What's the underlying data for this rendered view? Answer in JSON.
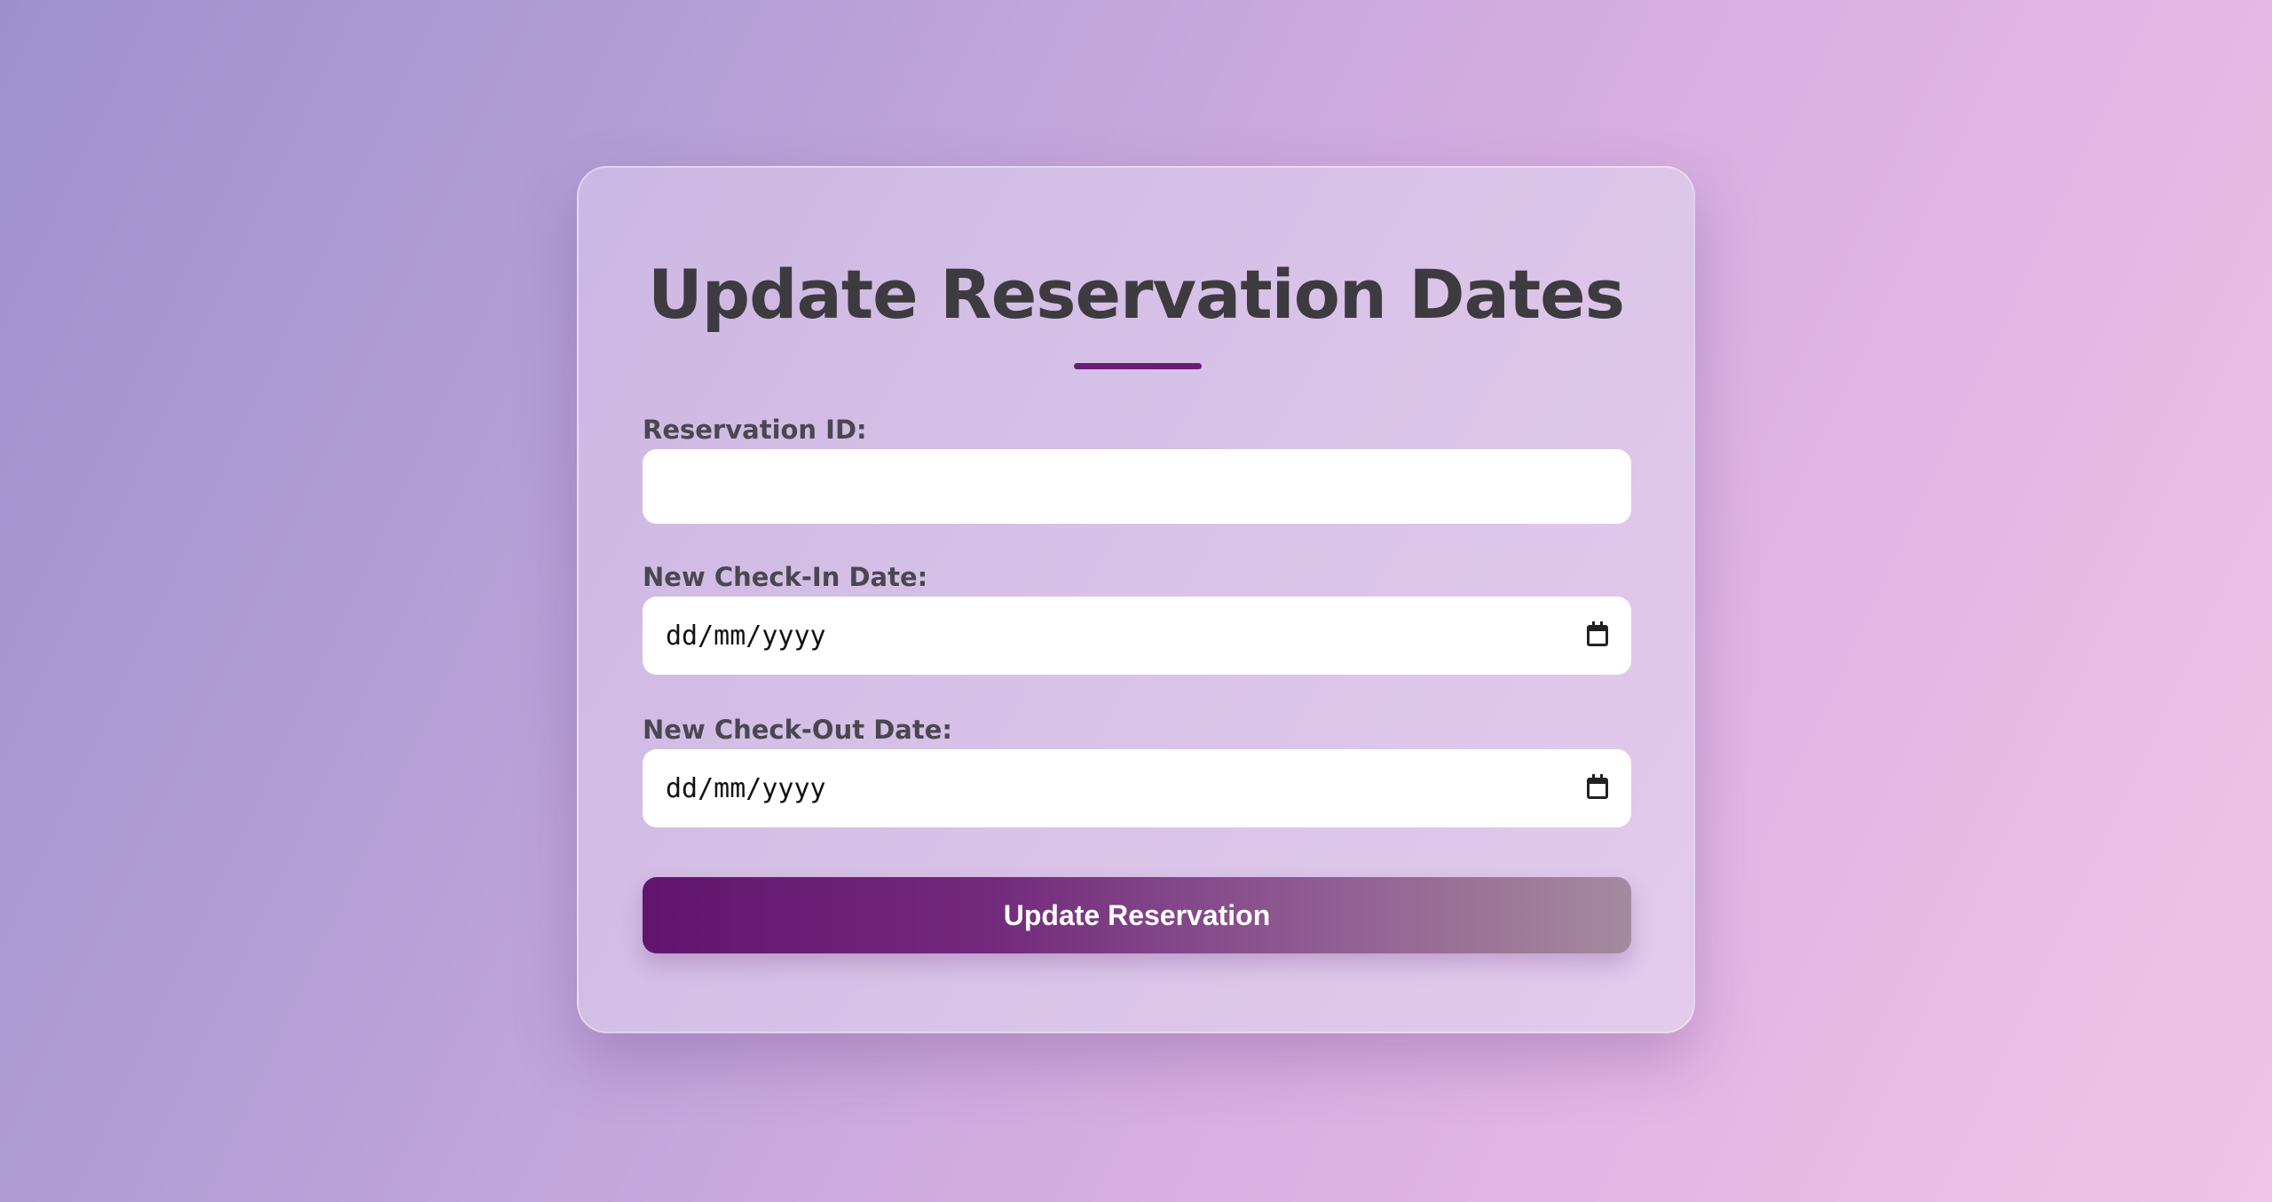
{
  "form": {
    "title": "Update Reservation Dates",
    "reservation_id": {
      "label": "Reservation ID:",
      "value": ""
    },
    "check_in": {
      "label": "New Check-In Date:",
      "placeholder": "dd/mm/yyyy",
      "icon": "calendar-icon"
    },
    "check_out": {
      "label": "New Check-Out Date:",
      "placeholder": "dd/mm/yyyy",
      "icon": "calendar-icon"
    },
    "submit_label": "Update Reservation"
  },
  "colors": {
    "accent": "#6a1b7a",
    "title_text": "#3e3b40",
    "label_text": "#4a4750",
    "button_gradient_start": "#62146e",
    "button_gradient_end": "#a58a9f"
  }
}
